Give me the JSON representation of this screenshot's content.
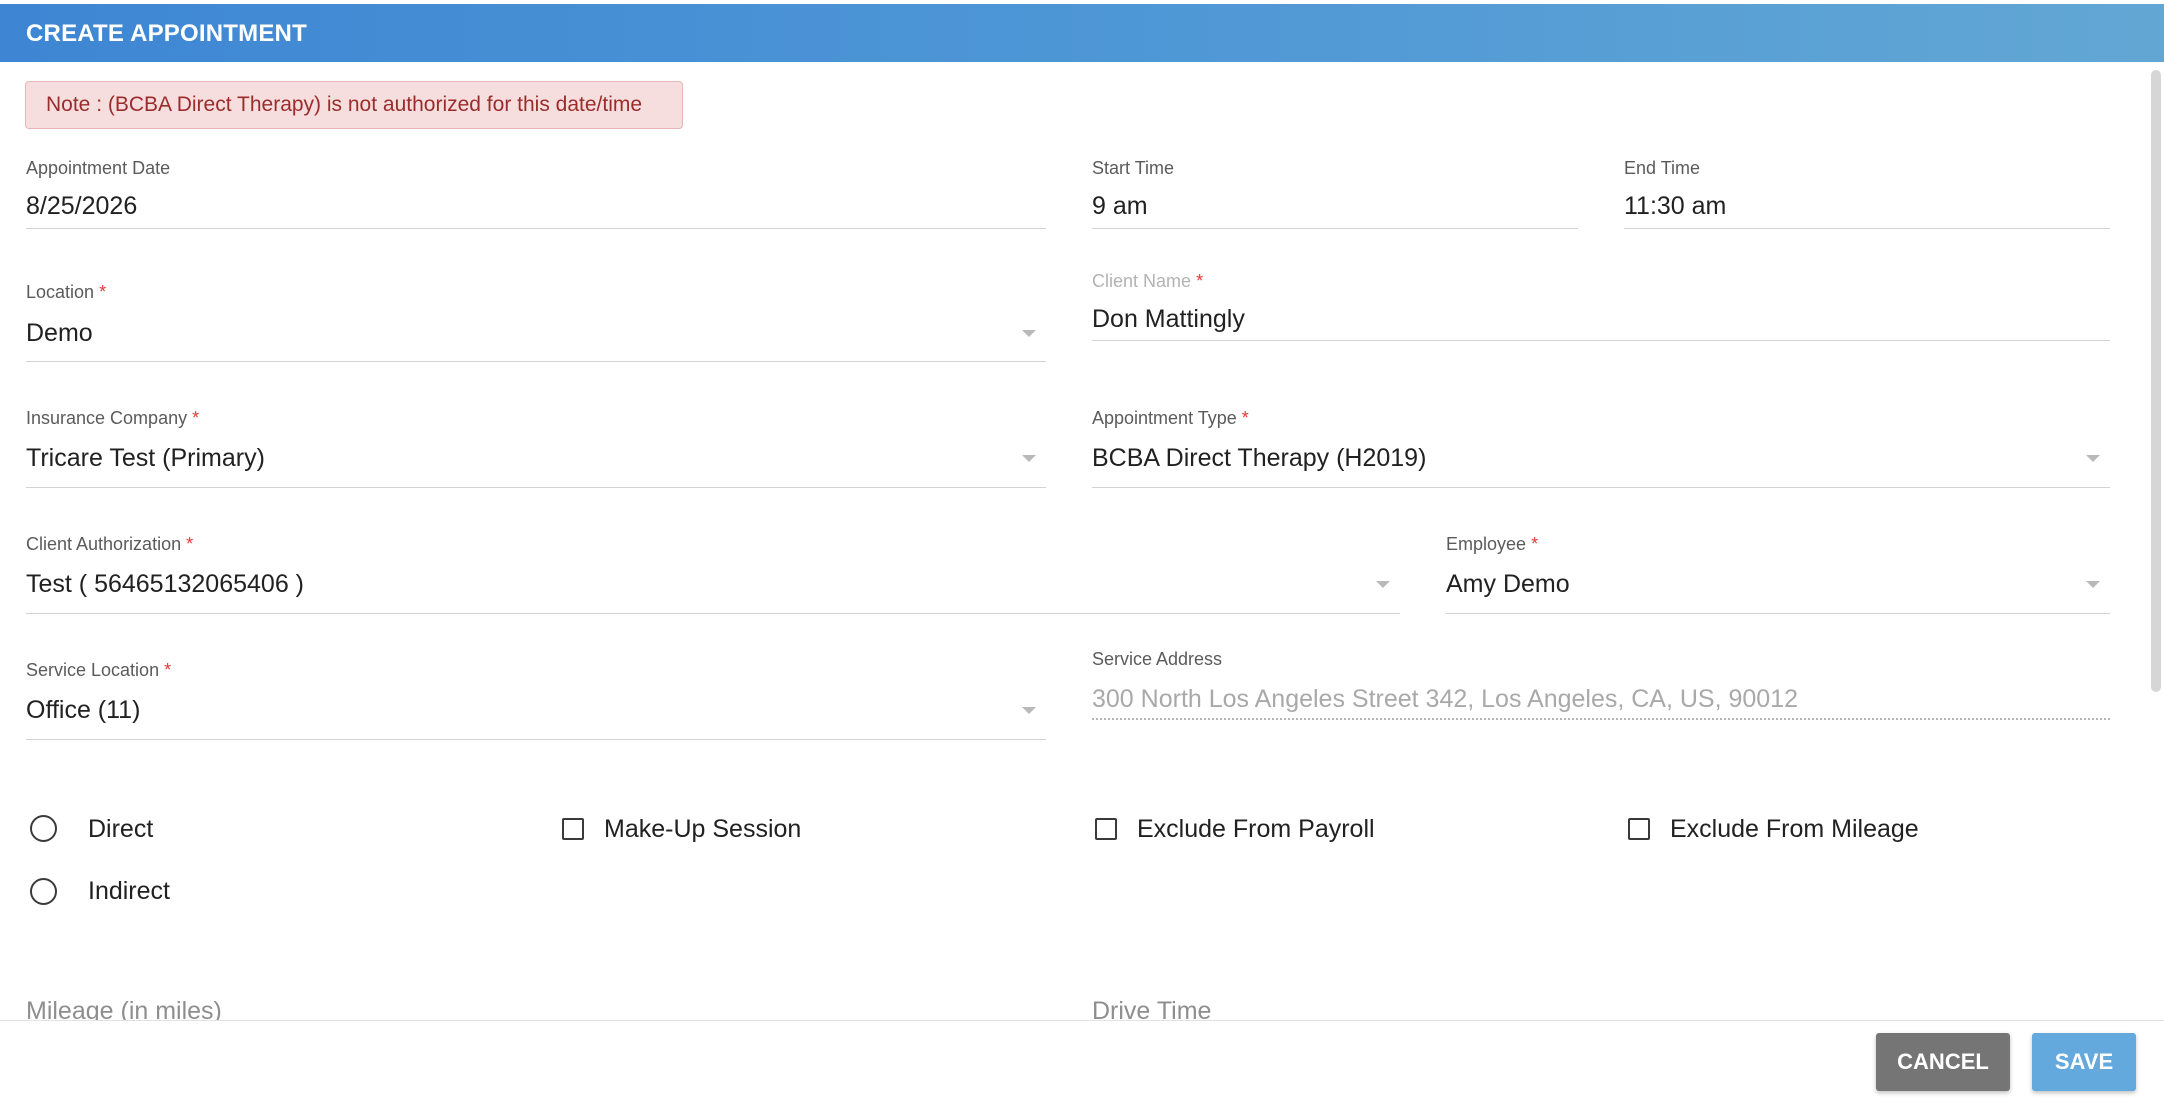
{
  "dialog": {
    "title": "CREATE APPOINTMENT"
  },
  "note": "Note : (BCBA Direct Therapy) is not authorized for this date/time",
  "fields": {
    "appointment_date": {
      "label": "Appointment Date",
      "value": "8/25/2026"
    },
    "start_time": {
      "label": "Start Time",
      "value": "9 am"
    },
    "end_time": {
      "label": "End Time",
      "value": "11:30 am"
    },
    "location": {
      "label": "Location",
      "value": "Demo"
    },
    "client_name": {
      "label": "Client Name",
      "value": "Don Mattingly"
    },
    "insurance_company": {
      "label": "Insurance Company",
      "value": "Tricare Test (Primary)"
    },
    "appointment_type": {
      "label": "Appointment Type",
      "value": "BCBA Direct Therapy (H2019)"
    },
    "client_authorization": {
      "label": "Client Authorization",
      "value": "Test ( 56465132065406 )"
    },
    "employee": {
      "label": "Employee",
      "value": "Amy Demo"
    },
    "service_location": {
      "label": "Service Location",
      "value": "Office (11)"
    },
    "service_address": {
      "label": "Service Address",
      "value": "300 North Los Angeles Street 342, Los Angeles, CA, US, 90012"
    }
  },
  "required_marker": "*",
  "options": {
    "direct": "Direct",
    "indirect": "Indirect",
    "makeup_session": "Make-Up Session",
    "exclude_payroll": "Exclude From Payroll",
    "exclude_mileage": "Exclude From Mileage"
  },
  "bottom_fields": {
    "mileage": "Mileage (in miles)",
    "drive_time": "Drive Time"
  },
  "buttons": {
    "cancel": "CANCEL",
    "save": "SAVE"
  },
  "colors": {
    "header": "#4a90d9",
    "note_bg": "#f7dede",
    "note_text": "#9b2c2c",
    "required": "#e53935",
    "cancel": "#757575",
    "save": "#63a9de"
  }
}
